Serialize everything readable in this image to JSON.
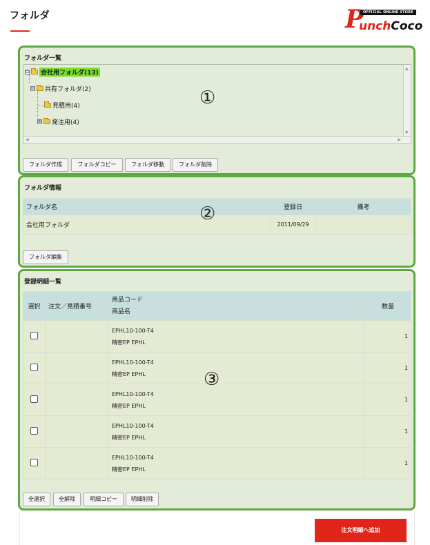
{
  "header": {
    "title": "フォルダ",
    "logo": {
      "ribbon": "OFFICIAL ONLINE STORE",
      "brand_initial": "P",
      "brand_red_part": "unch",
      "brand_black_part": "Coco"
    }
  },
  "colors": {
    "accent_red": "#e0261b",
    "panel_border_green": "#5ea93f",
    "panel_bg": "#e3ecd9",
    "selected_highlight": "#77e026",
    "table_header_bg": "#c7dfdd",
    "table_row_bg": "#e5ebd2"
  },
  "folder_list": {
    "heading": "フォルダ一覧",
    "annotation": "①",
    "tree": [
      {
        "label": "会社用フォルダ(13)",
        "toggle": "⊟",
        "selected": true
      },
      {
        "label": "共有フォルダ(2)",
        "toggle": "⊟",
        "selected": false
      },
      {
        "label": "見積用(4)",
        "toggle": "",
        "selected": false
      },
      {
        "label": "発注用(4)",
        "toggle": "⊞",
        "selected": false
      }
    ],
    "buttons": [
      "フォルダ作成",
      "フォルダコピー",
      "フォルダ移動",
      "フォルダ削除"
    ]
  },
  "folder_info": {
    "heading": "フォルダ情報",
    "annotation": "②",
    "columns": [
      "フォルダ名",
      "登録日",
      "備考"
    ],
    "row": {
      "name": "会社用フォルダ",
      "date": "2011/09/29",
      "note": ""
    },
    "edit_button": "フォルダ編集"
  },
  "detail_list": {
    "heading": "登録明細一覧",
    "annotation": "③",
    "columns": {
      "select": "選択",
      "order_no": "注文／見積番号",
      "code": "商品コード",
      "name": "商品名",
      "qty": "数量"
    },
    "rows": [
      {
        "order_no": "",
        "code": "EPHL10-100-T4",
        "name": "精密EP EPHL",
        "qty": "1"
      },
      {
        "order_no": "",
        "code": "EPHL10-100-T4",
        "name": "精密EP EPHL",
        "qty": "1"
      },
      {
        "order_no": "",
        "code": "EPHL10-100-T4",
        "name": "精密EP EPHL",
        "qty": "1"
      },
      {
        "order_no": "",
        "code": "EPHL10-100-T4",
        "name": "精密EP EPHL",
        "qty": "1"
      },
      {
        "order_no": "",
        "code": "EPHL10-100-T4",
        "name": "精密EP EPHL",
        "qty": "1"
      }
    ],
    "buttons": [
      "全選択",
      "全解除",
      "明細コピー",
      "明細削除"
    ]
  },
  "add_to_order_button": "注文明細へ追加"
}
